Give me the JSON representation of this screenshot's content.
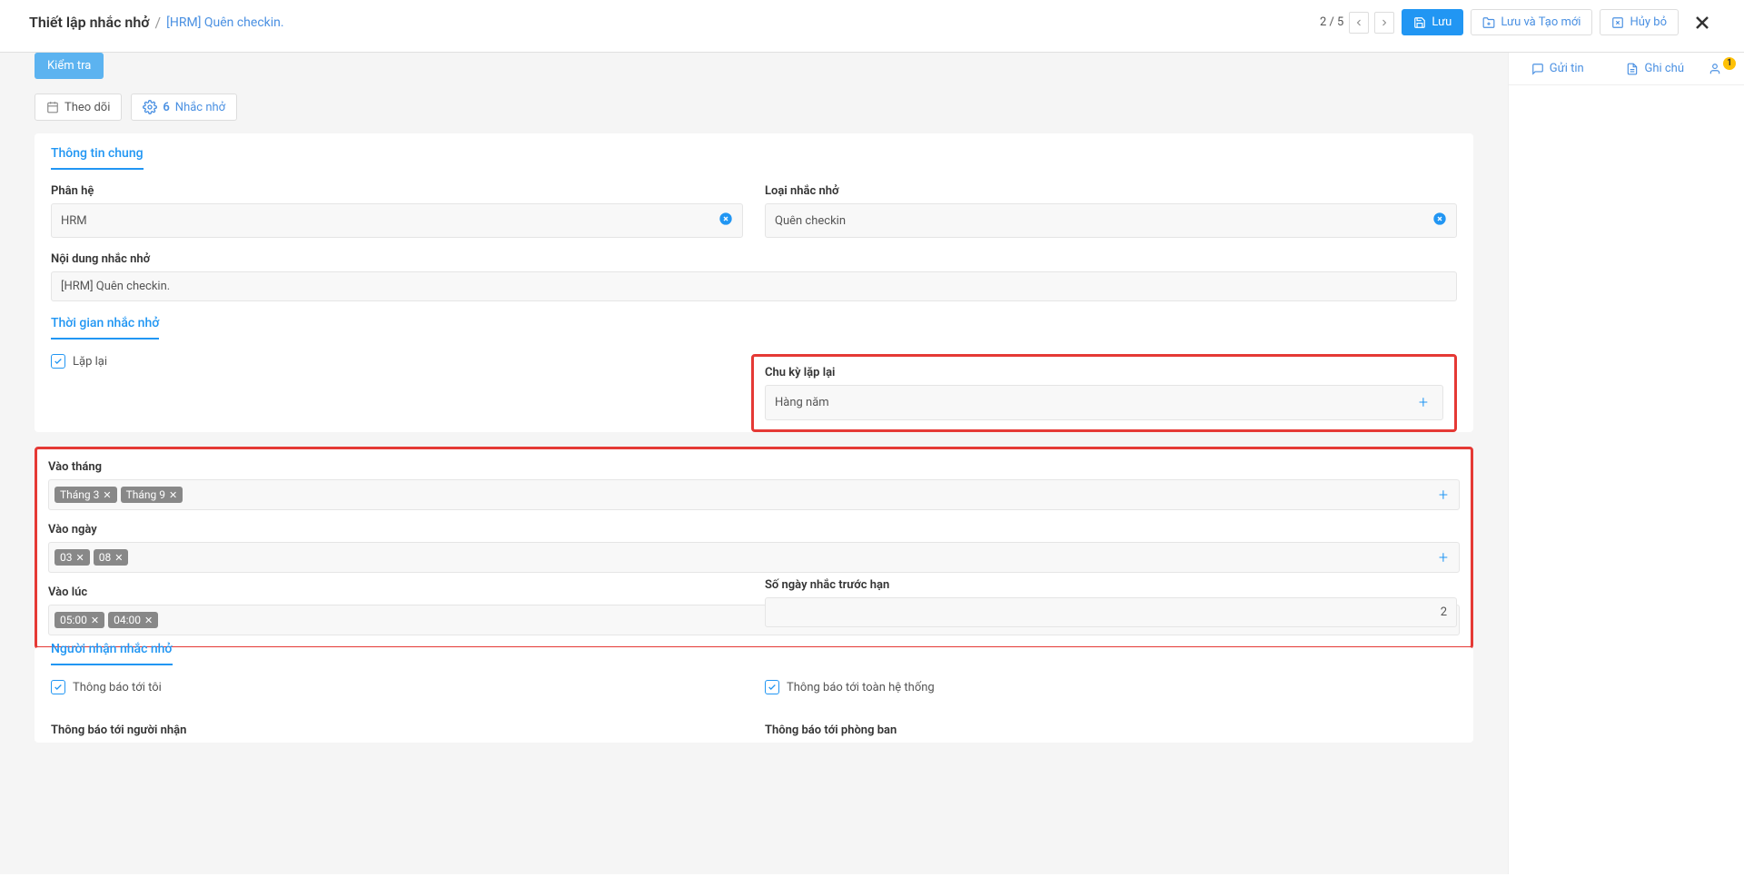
{
  "header": {
    "breadcrumb_main": "Thiết lập nhắc nhở",
    "breadcrumb_sub": "[HRM] Quên checkin.",
    "pager": "2 / 5",
    "save": "Lưu",
    "save_new": "Lưu và Tạo mới",
    "cancel": "Hủy bỏ"
  },
  "toolbar": {
    "test": "Kiểm tra",
    "follow": "Theo dõi",
    "reminders_count": "6",
    "reminders_label": "Nhắc nhở"
  },
  "section_general": {
    "title": "Thông tin chung",
    "subsystem_label": "Phân hệ",
    "subsystem_value": "HRM",
    "type_label": "Loại nhắc nhở",
    "type_value": "Quên checkin",
    "content_label": "Nội dung nhắc nhở",
    "content_value": "[HRM] Quên checkin."
  },
  "section_time": {
    "title": "Thời gian nhắc nhở",
    "repeat_label": "Lặp lại",
    "cycle_label": "Chu kỳ lặp lại",
    "cycle_value": "Hàng năm",
    "month_label": "Vào tháng",
    "month_chips": [
      "Tháng 3",
      "Tháng 9"
    ],
    "day_label": "Vào ngày",
    "day_chips": [
      "03",
      "08"
    ],
    "time_label": "Vào lúc",
    "time_chips": [
      "05:00",
      "04:00"
    ],
    "days_before_label": "Số ngày nhắc trước hạn",
    "days_before_value": "2"
  },
  "section_recipients": {
    "title": "Người nhận nhắc nhở",
    "notify_me": "Thông báo tới tôi",
    "notify_system": "Thông báo tới toàn hệ thống",
    "notify_recipient": "Thông báo tới người nhận",
    "notify_dept": "Thông báo tới phòng ban"
  },
  "right_panel": {
    "send_msg": "Gửi tin",
    "note": "Ghi chú",
    "badge": "1"
  }
}
